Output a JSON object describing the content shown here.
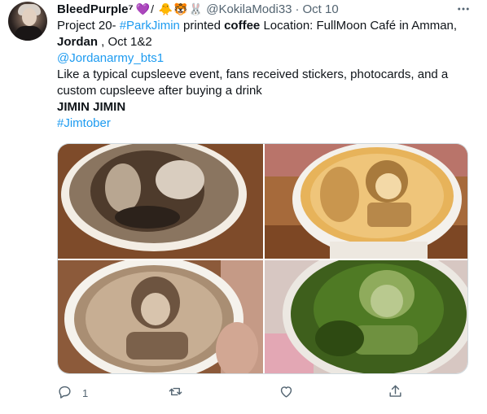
{
  "tweet": {
    "display_name": "BleedPurple⁷",
    "name_emojis": "💜/ 🐥🐯🐰",
    "handle": "@KokilaModi33",
    "separator": "·",
    "date": "Oct 10",
    "more_icon": "more-horizontal-icon",
    "text": {
      "l1_a": "Project 20- ",
      "l1_hashtag": "#ParkJimin",
      "l1_b": " printed ",
      "l1_bold": "coffee",
      "l1_c": "  Location: FullMoon Café in Amman,",
      "l2_bold": "Jordan",
      "l2_a": " , Oct 1&2",
      "l3_mention": "@Jordanarmy_bts1",
      "l4": " Like a typical cupsleeve event, fans received stickers, photocards, and a",
      "l5": "custom cupsleeve after buying a drink",
      "l6_bold": "JIMIN JIMIN",
      "l7_hashtag": "#Jimtober"
    },
    "media": [
      {
        "description_icon": "latte-art-photo-1"
      },
      {
        "description_icon": "latte-art-photo-2"
      },
      {
        "description_icon": "latte-art-photo-3"
      },
      {
        "description_icon": "matcha-art-photo-4"
      }
    ],
    "actions": {
      "reply_count": "1",
      "retweet_count": "",
      "like_count": "",
      "share_count": ""
    }
  },
  "colors": {
    "link": "#1d9bf0",
    "secondary_text": "#536471",
    "primary_text": "#0f1419",
    "border": "#cfd9de"
  }
}
